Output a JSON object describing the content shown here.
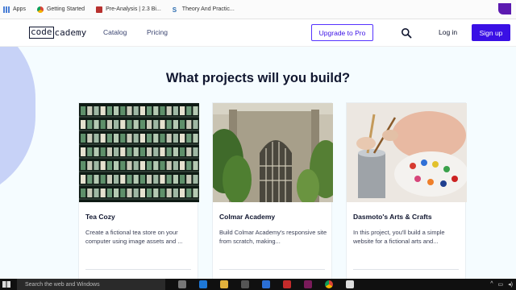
{
  "bookmarks": {
    "items": [
      {
        "label": "Apps",
        "icon": "apps-icon"
      },
      {
        "label": "Getting Started",
        "icon": "chrome-icon"
      },
      {
        "label": "Pre-Analysis | 2.3 Bi...",
        "icon": "pre-analysis-icon"
      },
      {
        "label": "Theory And Practic...",
        "icon": "s-icon"
      }
    ]
  },
  "header": {
    "logo_box": "code",
    "logo_rest": "cademy",
    "nav": [
      "Catalog",
      "Pricing"
    ],
    "upgrade_label": "Upgrade to Pro",
    "login_label": "Log in",
    "signup_label": "Sign up"
  },
  "main": {
    "heading": "What projects will you build?",
    "cards": [
      {
        "title": "Tea Cozy",
        "desc": "Create a fictional tea store on your computer using image assets and ..."
      },
      {
        "title": "Colmar Academy",
        "desc": "Build Colmar Academy's responsive site from scratch, making..."
      },
      {
        "title": "Dasmoto's Arts & Crafts",
        "desc": "In this project, you'll build a simple website for a fictional arts and..."
      }
    ]
  },
  "taskbar": {
    "search_placeholder": "Search the web and Windows"
  },
  "colors": {
    "brand": "#3a10e5",
    "ink": "#10162f",
    "page_bg": "#f5fcff",
    "blob": "#c7d2f7"
  }
}
